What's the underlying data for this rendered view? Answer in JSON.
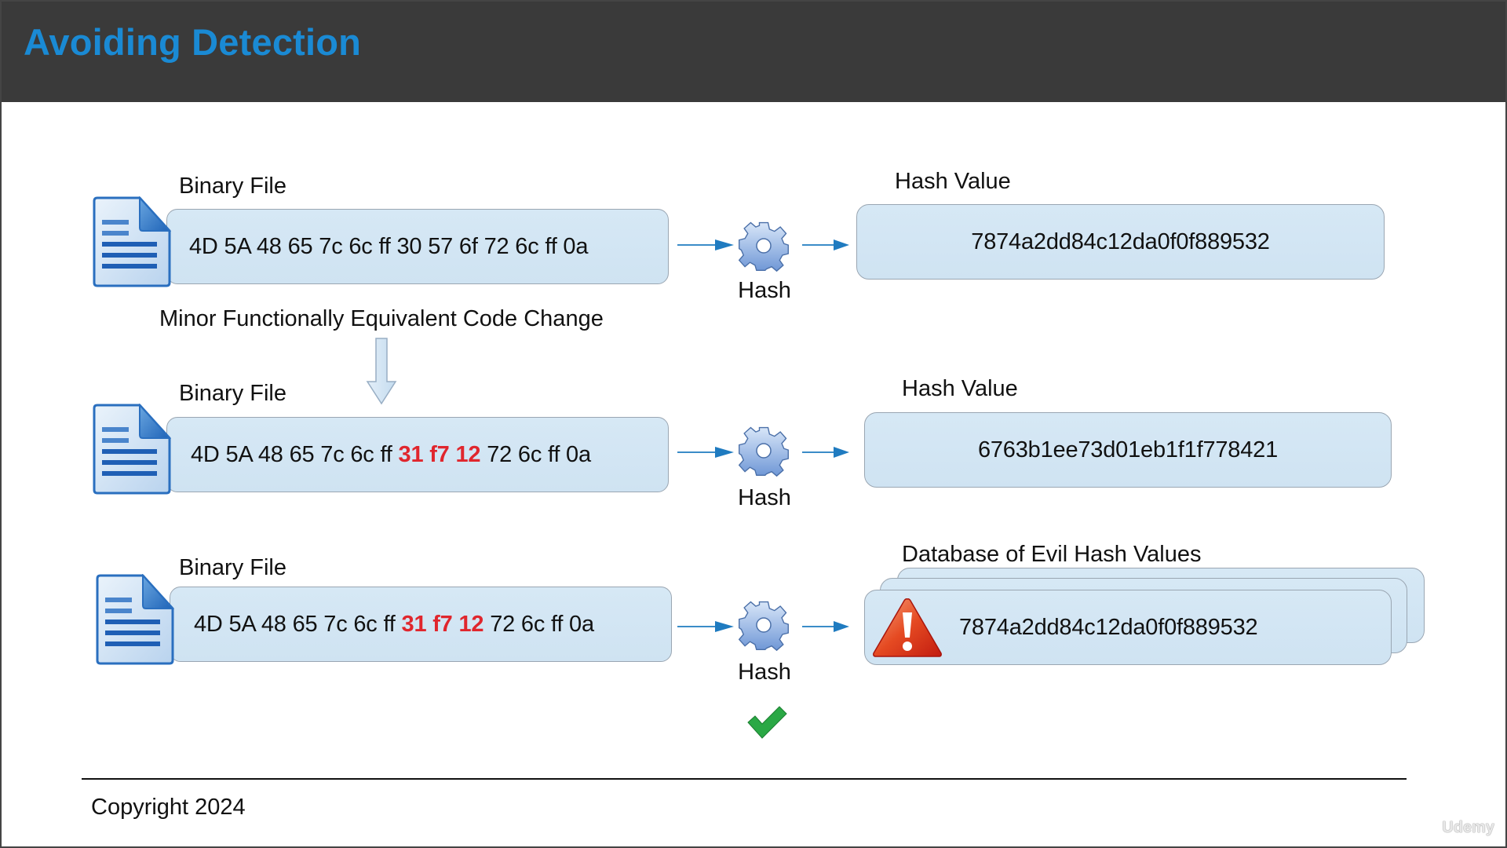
{
  "header": {
    "title": "Avoiding Detection"
  },
  "rows": [
    {
      "file_label": "Binary File",
      "bytes_before": "4D 5A 48 65 7c 6c ff 30 57 6f 72 6c ff 0a",
      "bytes_changed": "",
      "bytes_after": "",
      "hash_label": "Hash",
      "result_label": "Hash Value",
      "hash_value": "7874a2dd84c12da0f0f889532"
    },
    {
      "file_label": "Binary File",
      "bytes_before": "4D 5A 48 65 7c 6c ff ",
      "bytes_changed": "31 f7 12",
      "bytes_after": " 72 6c ff 0a",
      "hash_label": "Hash",
      "result_label": "Hash Value",
      "hash_value": "6763b1ee73d01eb1f1f778421"
    },
    {
      "file_label": "Binary File",
      "bytes_before": "4D 5A 48 65 7c 6c ff ",
      "bytes_changed": "31 f7 12",
      "bytes_after": " 72 6c ff 0a",
      "hash_label": "Hash",
      "result_label": "Database of Evil Hash Values",
      "hash_value": "7874a2dd84c12da0f0f889532"
    }
  ],
  "transition": {
    "label": "Minor Functionally Equivalent Code Change"
  },
  "icons": {
    "file": "document-icon",
    "process": "gear-icon",
    "warning": "warning-triangle-icon",
    "result": "checkmark-icon"
  },
  "colors": {
    "title": "#1a8ad4",
    "header_bg": "#3a3a3a",
    "changed_bytes": "#e0262d",
    "box_fill": "#d3e6f4",
    "arrow": "#1f7bc0",
    "check": "#2aa845"
  },
  "footer": {
    "copyright": "Copyright 2024",
    "watermark": "Udemy"
  }
}
